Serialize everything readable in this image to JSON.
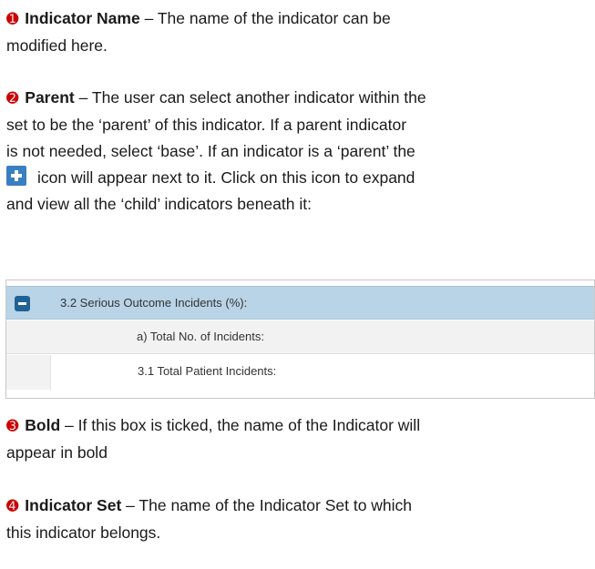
{
  "sections": [
    {
      "number": "➊",
      "term": "Indicator Name",
      "text_line1": " – The name of the indicator can be",
      "text_line2": "modified here."
    },
    {
      "number": "➋",
      "term": "Parent",
      "text_line1": " – The user can select another indicator within the",
      "text_line2": "set to be the ‘parent’ of this indicator. If a parent indicator",
      "text_line3": "is not needed, select ‘base’. If an indicator is a ‘parent’ the",
      "text_line4": "icon will appear next to it. Click on this icon to expand",
      "text_line5": "and view all the ‘child’ indicators beneath it:"
    },
    {
      "number": "➌",
      "term": "Bold",
      "text_line1": " – If this box is ticked, the name of the Indicator will",
      "text_line2": "appear in bold"
    },
    {
      "number": "➍",
      "term": "Indicator Set",
      "text_line1": " – The name of the Indicator Set to which",
      "text_line2": "this indicator belongs."
    }
  ],
  "tree": {
    "rows": [
      {
        "label": "3.2 Serious Outcome Incidents (%):",
        "expanded": true
      },
      {
        "label": "a) Total No. of Incidents:"
      },
      {
        "label": "3.1 Total Patient Incidents:"
      }
    ]
  },
  "icons": {
    "expand": "plus-icon",
    "collapse": "minus-icon"
  },
  "colors": {
    "number_markers": "#cc0000",
    "expand_icon": "#3a7fc1",
    "parent_row_bg": "#b8d4e6",
    "collapse_icon": "#1f6396"
  }
}
